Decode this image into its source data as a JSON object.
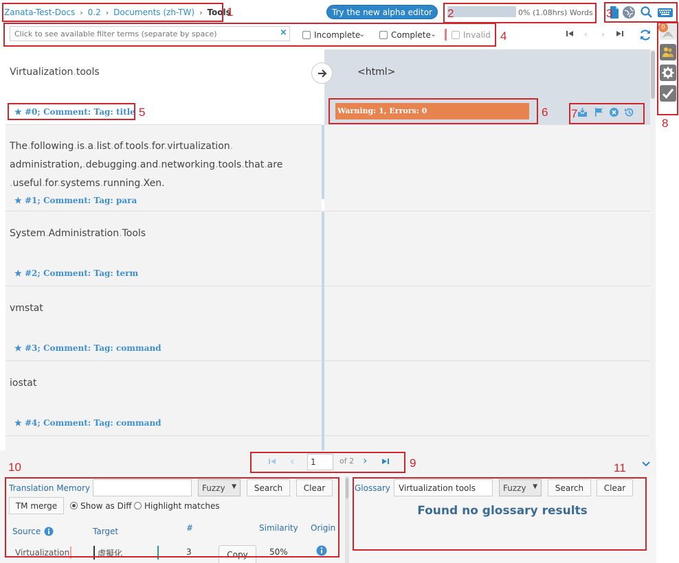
{
  "breadcrumb": {
    "items": [
      "Zanata-Test-Docs",
      "0.2",
      "Documents (zh-TW)",
      "Tools"
    ]
  },
  "header": {
    "alpha_button": "Try the new alpha editor",
    "progress_text": "0% (1.08hrs) Words",
    "progress_value": 0
  },
  "filter": {
    "placeholder": "Click to see available filter terms (separate by space)",
    "clear": "×",
    "incomplete_label": "Incomplete",
    "complete_label": "Complete",
    "invalid_label": "Invalid"
  },
  "editor": {
    "target_preview": "<html>",
    "validation": "Warning: 1, Errors: 0",
    "rows": [
      {
        "source": "Virtualization tools",
        "comment": "#0; Comment: Tag: title"
      },
      {
        "source_lines": [
          "The following is a list of tools for virtualization",
          "administration, debugging and networking tools that are",
          "useful for systems running Xen."
        ],
        "comment": "#1; Comment: Tag: para"
      },
      {
        "source": "System Administration Tools",
        "comment": "#2; Comment: Tag: term"
      },
      {
        "source": "vmstat",
        "comment": "#3; Comment: Tag: command"
      },
      {
        "source": "iostat",
        "comment": "#4; Comment: Tag: command"
      }
    ]
  },
  "rail": {
    "notification_count": "0"
  },
  "pager": {
    "page": "1",
    "of_text": "of 2"
  },
  "annotations": [
    "1",
    "2",
    "3",
    "4",
    "5",
    "6",
    "7",
    "8",
    "9",
    "10",
    "11"
  ],
  "tm": {
    "title": "Translation Memory",
    "mode": "Fuzzy",
    "search": "Search",
    "clear": "Clear",
    "merge": "TM merge",
    "show_diff": "Show as Diff",
    "highlight": "Highlight matches",
    "col_source": "Source",
    "col_target": "Target",
    "col_count": "#",
    "col_similarity": "Similarity",
    "col_origin": "Origin",
    "result": {
      "source": "Virtualization",
      "target": "虛擬化",
      "count": "3",
      "copy": "Copy",
      "similarity": "50%"
    }
  },
  "glossary": {
    "title": "Glossary",
    "query": "Virtualization tools",
    "mode": "Fuzzy",
    "search": "Search",
    "clear": "Clear",
    "empty": "Found no glossary results"
  }
}
